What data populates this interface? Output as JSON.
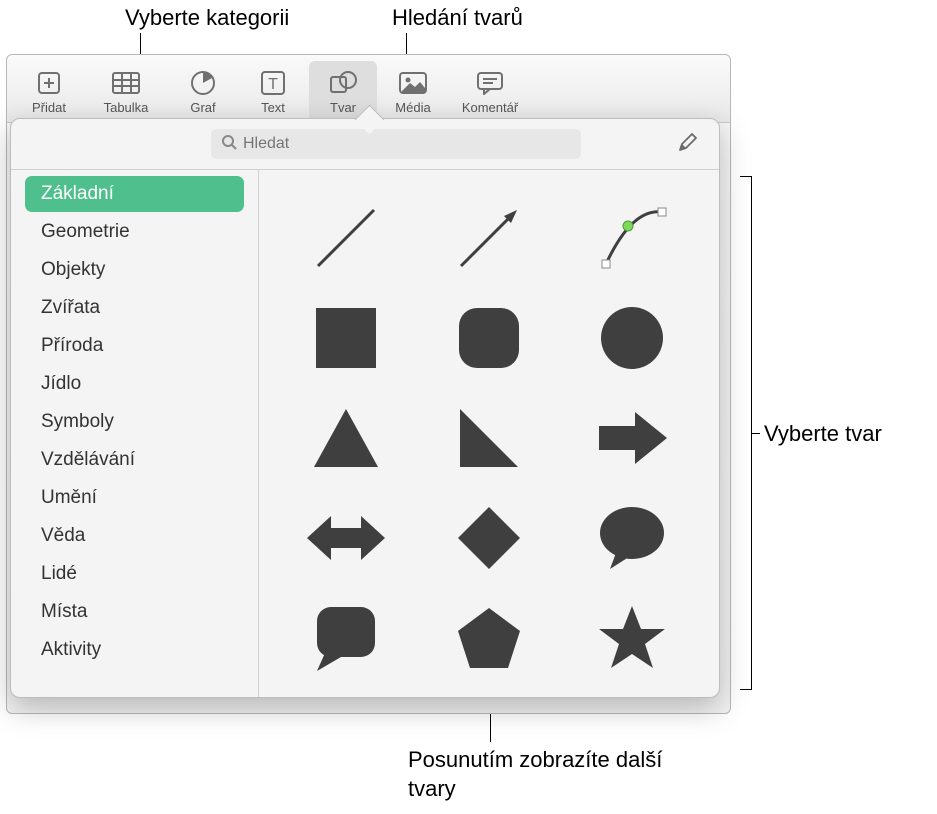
{
  "callouts": {
    "category": "Vyberte kategorii",
    "search": "Hledání tvarů",
    "select_shape": "Vyberte tvar",
    "scroll": "Posunutím zobrazíte další tvary"
  },
  "toolbar": {
    "items": [
      {
        "label": "Přidat",
        "icon": "plus-page"
      },
      {
        "label": "Tabulka",
        "icon": "table"
      },
      {
        "label": "Graf",
        "icon": "chart"
      },
      {
        "label": "Text",
        "icon": "text"
      },
      {
        "label": "Tvar",
        "icon": "shape",
        "active": true
      },
      {
        "label": "Média",
        "icon": "media"
      },
      {
        "label": "Komentář",
        "icon": "comment"
      }
    ]
  },
  "search": {
    "placeholder": "Hledat"
  },
  "sidebar": {
    "items": [
      {
        "label": "Základní",
        "selected": true
      },
      {
        "label": "Geometrie"
      },
      {
        "label": "Objekty"
      },
      {
        "label": "Zvířata"
      },
      {
        "label": "Příroda"
      },
      {
        "label": "Jídlo"
      },
      {
        "label": "Symboly"
      },
      {
        "label": "Vzdělávání"
      },
      {
        "label": "Umění"
      },
      {
        "label": "Věda"
      },
      {
        "label": "Lidé"
      },
      {
        "label": "Místa"
      },
      {
        "label": "Aktivity"
      }
    ]
  },
  "shapes": [
    {
      "name": "line"
    },
    {
      "name": "arrow-line"
    },
    {
      "name": "curve"
    },
    {
      "name": "square"
    },
    {
      "name": "rounded-square"
    },
    {
      "name": "circle"
    },
    {
      "name": "triangle"
    },
    {
      "name": "right-triangle"
    },
    {
      "name": "arrow-right"
    },
    {
      "name": "arrow-left-right"
    },
    {
      "name": "diamond"
    },
    {
      "name": "speech-bubble-round"
    },
    {
      "name": "speech-bubble-square"
    },
    {
      "name": "pentagon"
    },
    {
      "name": "star"
    }
  ],
  "colors": {
    "shape_fill": "#3f3f3f",
    "accent": "#4fc08d"
  }
}
